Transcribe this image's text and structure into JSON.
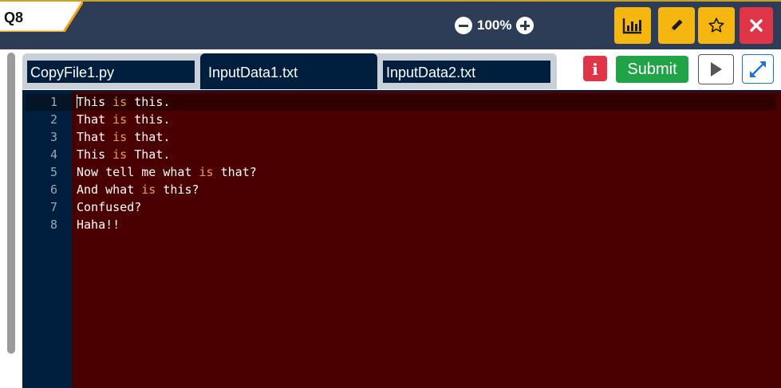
{
  "question_label": "Q8",
  "zoom": {
    "value": "100%"
  },
  "toolbar": [
    {
      "name": "stats",
      "icon": "bar-chart-icon",
      "color": "#f5b60f"
    },
    {
      "name": "edit",
      "icon": "pencil-icon",
      "color": "#f5b60f"
    },
    {
      "name": "favorite",
      "icon": "star-icon",
      "color": "#f5b60f"
    },
    {
      "name": "close",
      "icon": "close-icon",
      "color": "#e03546"
    }
  ],
  "tabs": [
    {
      "label": "CopyFile1.py",
      "active": false
    },
    {
      "label": "InputData1.txt",
      "active": true
    },
    {
      "label": "InputData2.txt",
      "active": false
    }
  ],
  "actions": {
    "submit_label": "Submit",
    "info_label": "i"
  },
  "editor": {
    "lines": [
      {
        "number": "1",
        "segments": [
          {
            "text": "This "
          },
          {
            "text": "is",
            "kw": true
          },
          {
            "text": " this."
          }
        ]
      },
      {
        "number": "2",
        "segments": [
          {
            "text": "That "
          },
          {
            "text": "is",
            "kw": true
          },
          {
            "text": " this."
          }
        ]
      },
      {
        "number": "3",
        "segments": [
          {
            "text": "That "
          },
          {
            "text": "is",
            "kw": true
          },
          {
            "text": " that."
          }
        ]
      },
      {
        "number": "4",
        "segments": [
          {
            "text": "This "
          },
          {
            "text": "is",
            "kw": true
          },
          {
            "text": " That."
          }
        ]
      },
      {
        "number": "5",
        "segments": [
          {
            "text": "Now tell me what "
          },
          {
            "text": "is",
            "kw": true
          },
          {
            "text": " that?"
          }
        ]
      },
      {
        "number": "6",
        "segments": [
          {
            "text": "And what "
          },
          {
            "text": "is",
            "kw": true
          },
          {
            "text": " this?"
          }
        ]
      },
      {
        "number": "7",
        "segments": [
          {
            "text": "Confused?"
          }
        ]
      },
      {
        "number": "8",
        "segments": [
          {
            "text": "Haha!!"
          }
        ]
      }
    ]
  },
  "colors": {
    "topbar": "#2e3d57",
    "accent_yellow": "#f5b60f",
    "danger": "#e03546",
    "success": "#21a447",
    "editor_bg": "#4a0000",
    "gutter_bg": "#001f3f",
    "keyword": "#f0a040"
  }
}
